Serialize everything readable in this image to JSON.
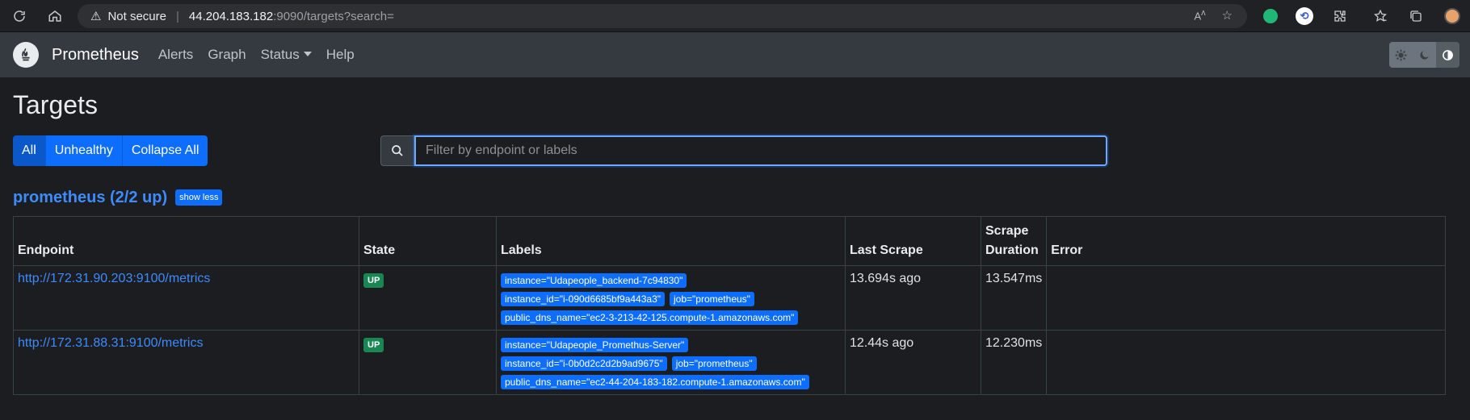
{
  "browser": {
    "security_label": "Not secure",
    "url_host": "44.204.183.182",
    "url_path": ":9090/targets?search="
  },
  "navbar": {
    "brand": "Prometheus",
    "links": [
      "Alerts",
      "Graph",
      "Status",
      "Help"
    ]
  },
  "page": {
    "title": "Targets",
    "filters": [
      "All",
      "Unhealthy",
      "Collapse All"
    ],
    "search_placeholder": "Filter by endpoint or labels"
  },
  "pool": {
    "title": "prometheus (2/2 up)",
    "toggle_label": "show less",
    "columns": [
      "Endpoint",
      "State",
      "Labels",
      "Last Scrape",
      "Scrape Duration",
      "Error"
    ],
    "rows": [
      {
        "endpoint": "http://172.31.90.203:9100/metrics",
        "state": "UP",
        "labels": [
          "instance=\"Udapeople_backend-7c94830\"",
          "instance_id=\"i-090d6685bf9a443a3\"",
          "job=\"prometheus\"",
          "public_dns_name=\"ec2-3-213-42-125.compute-1.amazonaws.com\""
        ],
        "last_scrape": "13.694s ago",
        "duration": "13.547ms",
        "error": ""
      },
      {
        "endpoint": "http://172.31.88.31:9100/metrics",
        "state": "UP",
        "labels": [
          "instance=\"Udapeople_Promethus-Server\"",
          "instance_id=\"i-0b0d2c2d2b9ad9675\"",
          "job=\"prometheus\"",
          "public_dns_name=\"ec2-44-204-183-182.compute-1.amazonaws.com\""
        ],
        "last_scrape": "12.44s ago",
        "duration": "12.230ms",
        "error": ""
      }
    ]
  },
  "colors": {
    "accent": "#0d6efd",
    "up": "#198754",
    "navbar": "#343a40",
    "background": "#1b1d21"
  }
}
